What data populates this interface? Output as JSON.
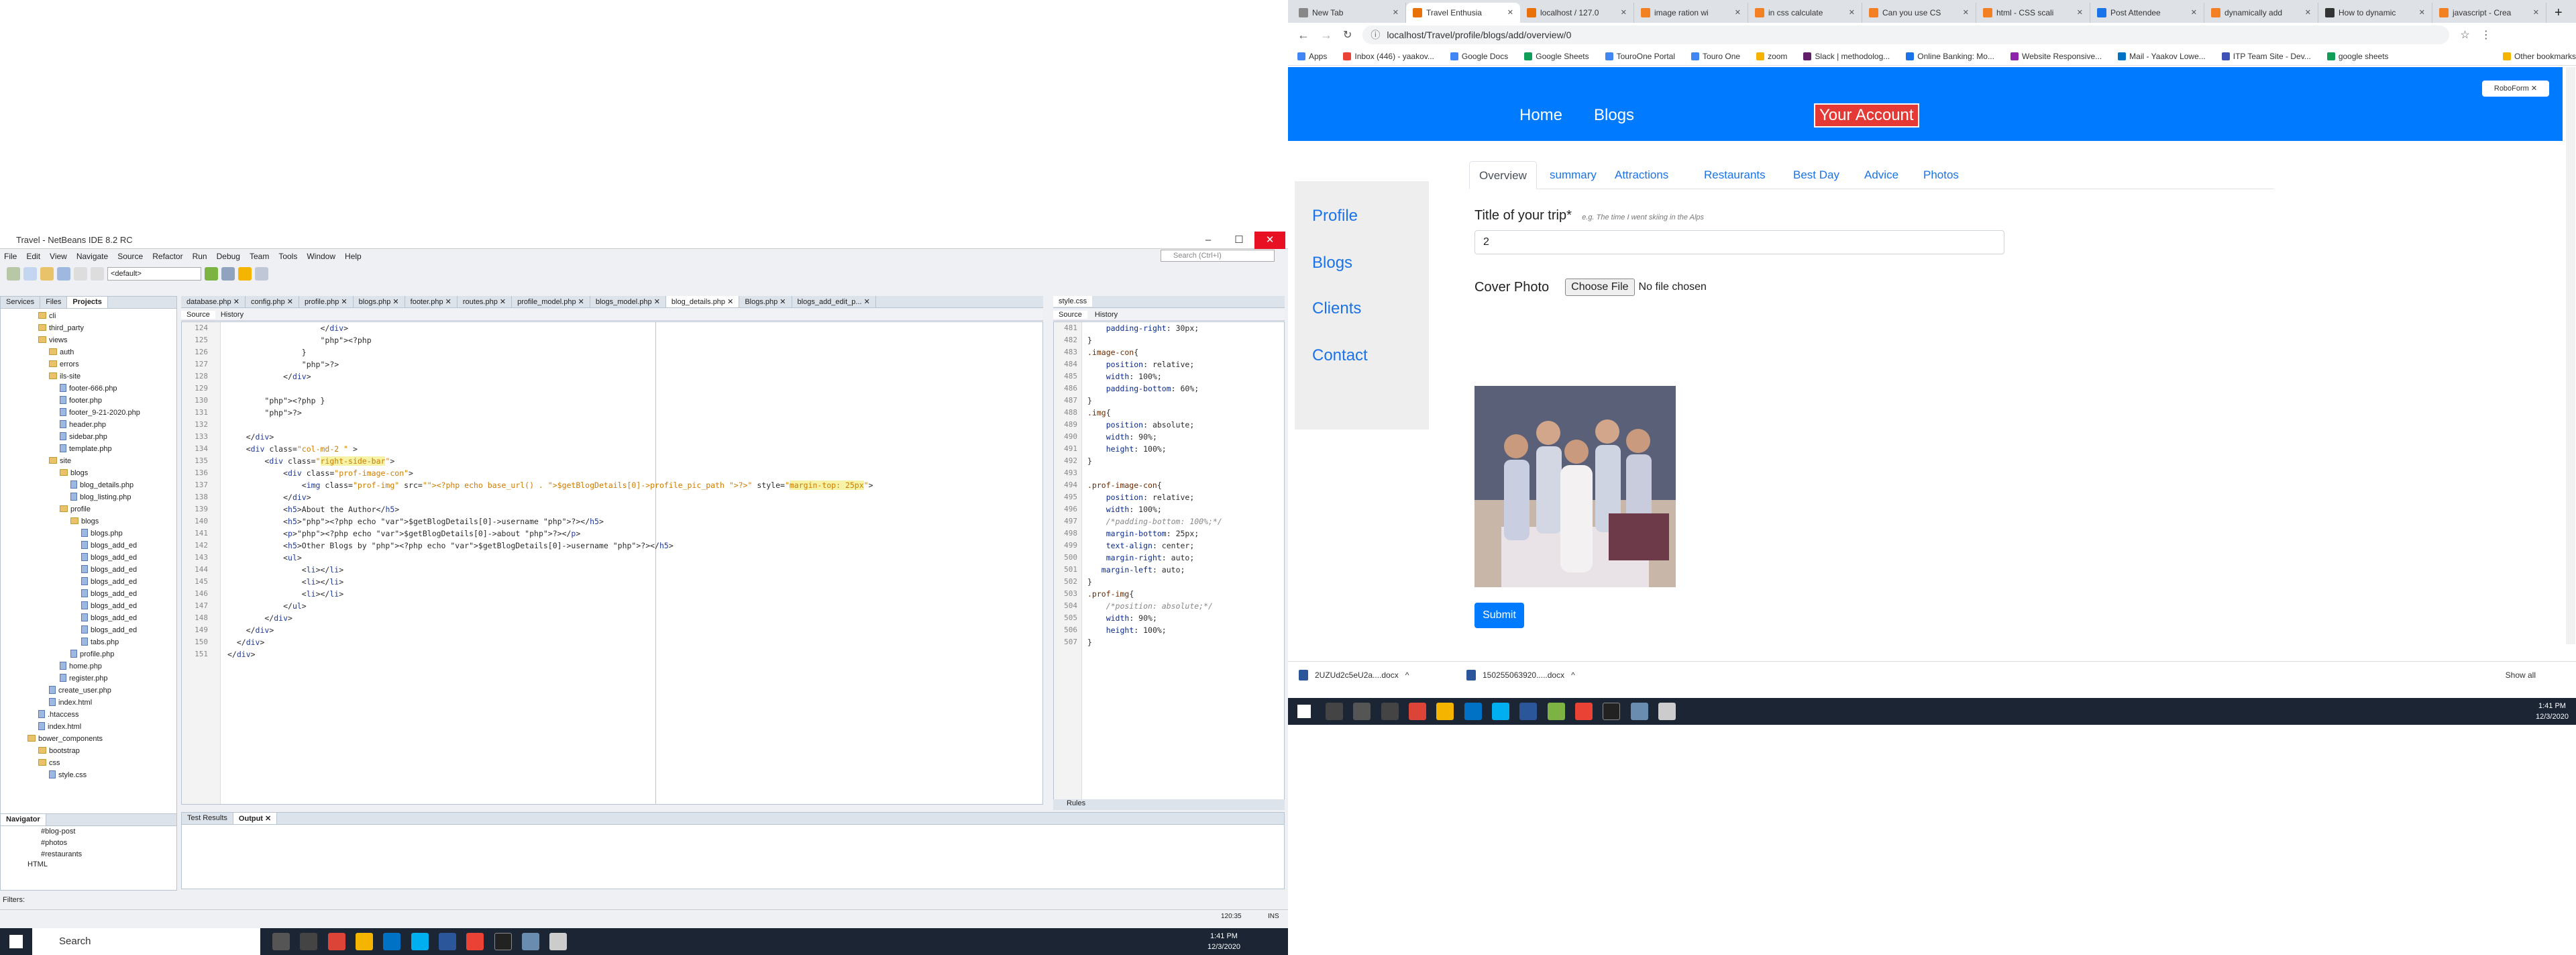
{
  "netbeans": {
    "title": "Travel - NetBeans IDE 8.2 RC",
    "menu": [
      "File",
      "Edit",
      "View",
      "Navigate",
      "Source",
      "Refactor",
      "Run",
      "Debug",
      "Team",
      "Tools",
      "Window",
      "Help"
    ],
    "search_placeholder": "Search (Ctrl+I)",
    "config": "<default>",
    "panel_tabs": [
      "Services",
      "Files",
      "Projects"
    ],
    "tree": [
      {
        "d": 1,
        "t": "folder",
        "n": "cli"
      },
      {
        "d": 1,
        "t": "folder",
        "n": "third_party"
      },
      {
        "d": 1,
        "t": "folder",
        "n": "views"
      },
      {
        "d": 2,
        "t": "folder",
        "n": "auth"
      },
      {
        "d": 2,
        "t": "folder",
        "n": "errors"
      },
      {
        "d": 2,
        "t": "folder",
        "n": "ils-site"
      },
      {
        "d": 3,
        "t": "file",
        "n": "footer-666.php"
      },
      {
        "d": 3,
        "t": "file",
        "n": "footer.php"
      },
      {
        "d": 3,
        "t": "file",
        "n": "footer_9-21-2020.php"
      },
      {
        "d": 3,
        "t": "file",
        "n": "header.php"
      },
      {
        "d": 3,
        "t": "file",
        "n": "sidebar.php"
      },
      {
        "d": 3,
        "t": "file",
        "n": "template.php"
      },
      {
        "d": 2,
        "t": "folder",
        "n": "site"
      },
      {
        "d": 3,
        "t": "folder",
        "n": "blogs"
      },
      {
        "d": 4,
        "t": "file",
        "n": "blog_details.php"
      },
      {
        "d": 4,
        "t": "file",
        "n": "blog_listing.php"
      },
      {
        "d": 3,
        "t": "folder",
        "n": "profile"
      },
      {
        "d": 4,
        "t": "folder",
        "n": "blogs"
      },
      {
        "d": 5,
        "t": "file",
        "n": "blogs.php"
      },
      {
        "d": 5,
        "t": "file",
        "n": "blogs_add_ed"
      },
      {
        "d": 5,
        "t": "file",
        "n": "blogs_add_ed"
      },
      {
        "d": 5,
        "t": "file",
        "n": "blogs_add_ed"
      },
      {
        "d": 5,
        "t": "file",
        "n": "blogs_add_ed"
      },
      {
        "d": 5,
        "t": "file",
        "n": "blogs_add_ed"
      },
      {
        "d": 5,
        "t": "file",
        "n": "blogs_add_ed"
      },
      {
        "d": 5,
        "t": "file",
        "n": "blogs_add_ed"
      },
      {
        "d": 5,
        "t": "file",
        "n": "blogs_add_ed"
      },
      {
        "d": 5,
        "t": "file",
        "n": "tabs.php"
      },
      {
        "d": 4,
        "t": "file",
        "n": "profile.php"
      },
      {
        "d": 3,
        "t": "file",
        "n": "home.php"
      },
      {
        "d": 3,
        "t": "file",
        "n": "register.php"
      },
      {
        "d": 2,
        "t": "file",
        "n": "create_user.php"
      },
      {
        "d": 2,
        "t": "file",
        "n": "index.html"
      },
      {
        "d": 1,
        "t": "file",
        "n": ".htaccess"
      },
      {
        "d": 1,
        "t": "file",
        "n": "index.html"
      },
      {
        "d": 0,
        "t": "folder",
        "n": "bower_components"
      },
      {
        "d": 1,
        "t": "folder",
        "n": "bootstrap"
      },
      {
        "d": 1,
        "t": "folder",
        "n": "css"
      },
      {
        "d": 2,
        "t": "file",
        "n": "style.css"
      }
    ],
    "editor_tabs": [
      "database.php",
      "config.php",
      "profile.php",
      "blogs.php",
      "footer.php",
      "routes.php",
      "profile_model.php",
      "blogs_model.php",
      "blog_details.php",
      "Blogs.php",
      "blogs_add_edit_p..."
    ],
    "editor_active": "blog_details.php",
    "editor_bar": [
      "Source",
      "History"
    ],
    "code_lines": [
      {
        "n": "124",
        "c": "                    </div>"
      },
      {
        "n": "125",
        "c": "                    <?php"
      },
      {
        "n": "126",
        "c": "                }"
      },
      {
        "n": "127",
        "c": "                ?>"
      },
      {
        "n": "128",
        "c": "            </div>"
      },
      {
        "n": "129",
        "c": ""
      },
      {
        "n": "130",
        "c": "        <?php }"
      },
      {
        "n": "131",
        "c": "        ?>"
      },
      {
        "n": "132",
        "c": ""
      },
      {
        "n": "133",
        "c": "    </div>"
      },
      {
        "n": "134",
        "c": "    <div class=\"col-md-2 \" >"
      },
      {
        "n": "135",
        "c": "        <div class=\"right-side-bar\">"
      },
      {
        "n": "136",
        "c": "            <div class=\"prof-image-con\">"
      },
      {
        "n": "137",
        "c": "                <img class=\"prof-img\" src=\"<?php echo base_url() . $getBlogDetails[0]->profile_pic_path ?>\" style=\"margin-top: 25px\">"
      },
      {
        "n": "138",
        "c": "            </div>"
      },
      {
        "n": "139",
        "c": "            <h5>About the Author</h5>"
      },
      {
        "n": "140",
        "c": "            <h5><?php echo $getBlogDetails[0]->username ?></h5>"
      },
      {
        "n": "141",
        "c": "            <p><?php echo $getBlogDetails[0]->about ?></p>"
      },
      {
        "n": "142",
        "c": "            <h5>Other Blogs by <?php echo $getBlogDetails[0]->username ?></h5>"
      },
      {
        "n": "143",
        "c": "            <ul>"
      },
      {
        "n": "144",
        "c": "                <li></li>"
      },
      {
        "n": "145",
        "c": "                <li></li>"
      },
      {
        "n": "146",
        "c": "                <li></li>"
      },
      {
        "n": "147",
        "c": "            </ul>"
      },
      {
        "n": "148",
        "c": "        </div>"
      },
      {
        "n": "149",
        "c": "    </div>"
      },
      {
        "n": "150",
        "c": "  </div>"
      },
      {
        "n": "151",
        "c": "</div>"
      }
    ],
    "css_tab": "style.css",
    "css_lines": [
      {
        "n": "481",
        "c": "    padding-right: 30px;"
      },
      {
        "n": "482",
        "c": "}"
      },
      {
        "n": "483",
        "c": ".image-con{"
      },
      {
        "n": "484",
        "c": "    position: relative;"
      },
      {
        "n": "485",
        "c": "    width: 100%;"
      },
      {
        "n": "486",
        "c": "    padding-bottom: 60%;"
      },
      {
        "n": "487",
        "c": "}"
      },
      {
        "n": "488",
        "c": ".img{"
      },
      {
        "n": "489",
        "c": "    position: absolute;"
      },
      {
        "n": "490",
        "c": "    width: 90%;"
      },
      {
        "n": "491",
        "c": "    height: 100%;"
      },
      {
        "n": "492",
        "c": "}"
      },
      {
        "n": "493",
        "c": ""
      },
      {
        "n": "494",
        "c": ".prof-image-con{"
      },
      {
        "n": "495",
        "c": "    position: relative;"
      },
      {
        "n": "496",
        "c": "    width: 100%;"
      },
      {
        "n": "497",
        "c": "    /*padding-bottom: 100%;*/"
      },
      {
        "n": "498",
        "c": "    margin-bottom: 25px;"
      },
      {
        "n": "499",
        "c": "    text-align: center;"
      },
      {
        "n": "500",
        "c": "    margin-right: auto;"
      },
      {
        "n": "501",
        "c": "   margin-left: auto;"
      },
      {
        "n": "502",
        "c": "}"
      },
      {
        "n": "503",
        "c": ".prof-img{"
      },
      {
        "n": "504",
        "c": "    /*position: absolute;*/"
      },
      {
        "n": "505",
        "c": "    width: 90%;"
      },
      {
        "n": "506",
        "c": "    height: 100%;"
      },
      {
        "n": "507",
        "c": "}"
      }
    ],
    "navigator_title": "Navigator",
    "navigator_items": [
      "#blog-post",
      "#photos",
      "#restaurants"
    ],
    "navigator_html": "HTML",
    "filters_label": "Filters:",
    "output_tabs": [
      "Test Results",
      "Output"
    ],
    "rules_tab": "Rules",
    "cursor_pos": "120:35",
    "ins_mode": "INS"
  },
  "taskbar_left": {
    "search": "Search",
    "time": "1:41 PM",
    "date": "12/3/2020"
  },
  "chrome": {
    "tabs": [
      {
        "label": "New Tab",
        "color": "#888"
      },
      {
        "label": "Travel Enthusia",
        "color": "#e8710a"
      },
      {
        "label": "localhost / 127.0",
        "color": "#e8710a"
      },
      {
        "label": "image ration wi",
        "color": "#f48024"
      },
      {
        "label": "in css calculate",
        "color": "#f48024"
      },
      {
        "label": "Can you use CS",
        "color": "#f48024"
      },
      {
        "label": "html - CSS scali",
        "color": "#f48024"
      },
      {
        "label": "Post Attendee",
        "color": "#1a73e8"
      },
      {
        "label": "dynamically add",
        "color": "#f48024"
      },
      {
        "label": "How to dynamic",
        "color": "#333"
      },
      {
        "label": "javascript - Crea",
        "color": "#f48024"
      }
    ],
    "active_tab": 1,
    "url": "localhost/Travel/profile/blogs/add/overview/0",
    "bookmarks": [
      "Apps",
      "Inbox (446) - yaakov...",
      "Google Docs",
      "Google Sheets",
      "TouroOne Portal",
      "Touro One",
      "zoom",
      "Slack | methodolog...",
      "Online Banking: Mo...",
      "Website Responsive...",
      "Mail - Yaakov Lowe...",
      "ITP Team Site - Dev...",
      "google sheets",
      "Other bookmarks"
    ],
    "downloads": [
      "2UZUd2c5eU2a....docx",
      "150255063920.....docx"
    ],
    "show_all": "Show all"
  },
  "site": {
    "nav": [
      "Home",
      "Blogs"
    ],
    "account": "Your Account",
    "roboform": "RoboForm",
    "sidebar": [
      "Profile",
      "Blogs",
      "Clients",
      "Contact"
    ],
    "tabs": [
      "Overview",
      "summary",
      "Attractions",
      "Restaurants",
      "Best Day",
      "Advice",
      "Photos"
    ],
    "active_tab": 0,
    "title_label": "Title of your trip*",
    "title_hint": "e.g. The time I went skiing in the Alps",
    "title_value": "2",
    "cover_label": "Cover Photo",
    "choose_file": "Choose File",
    "no_file": "No file chosen",
    "submit": "Submit"
  },
  "taskbar_right": {
    "time": "1:41 PM",
    "date": "12/3/2020"
  }
}
